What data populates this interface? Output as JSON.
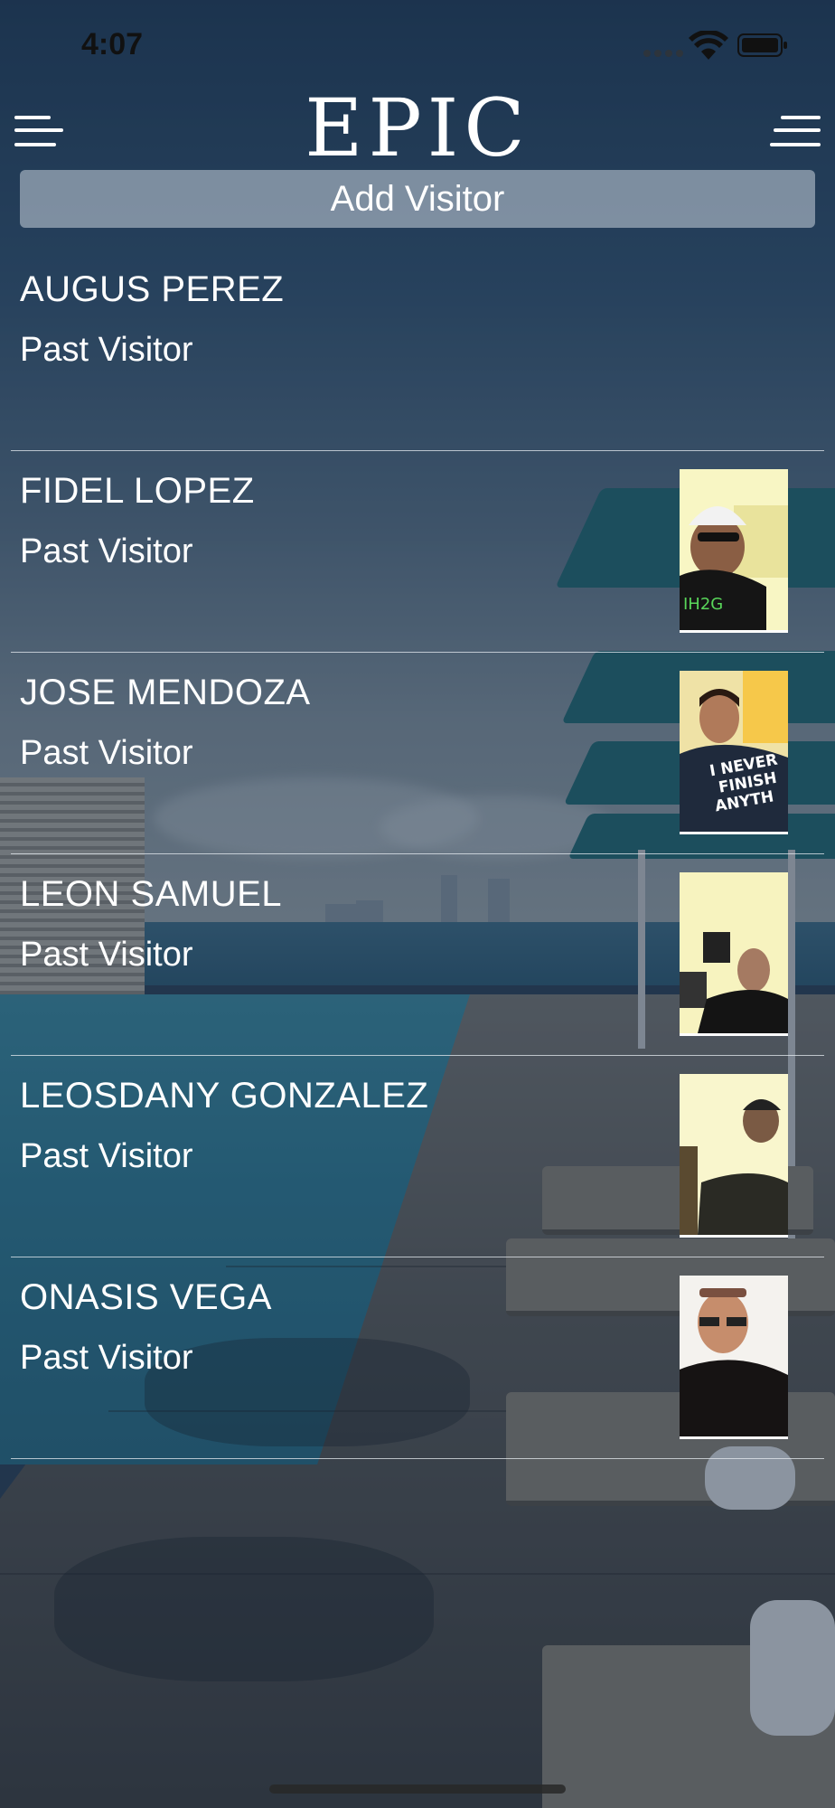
{
  "status_bar": {
    "time": "4:07",
    "icons": [
      "signal-dots-icon",
      "wifi-icon",
      "battery-icon"
    ]
  },
  "nav": {
    "logo": "EPIC",
    "left_icon": "menu-icon",
    "right_icon": "menu-icon"
  },
  "add_visitor": {
    "label": "Add Visitor"
  },
  "visitors": [
    {
      "name": "AUGUS PEREZ",
      "status": "Past Visitor",
      "has_photo": false
    },
    {
      "name": "FIDEL LOPEZ",
      "status": "Past Visitor",
      "has_photo": true,
      "photo": "photo-hat-man"
    },
    {
      "name": "JOSE MENDOZA",
      "status": "Past Visitor",
      "has_photo": true,
      "photo": "photo-shirt-man",
      "shirt_text": "I NEVER FINISH ANYTH"
    },
    {
      "name": "LEON SAMUEL",
      "status": "Past Visitor",
      "has_photo": true,
      "photo": "photo-monitor-man"
    },
    {
      "name": "LEOSDANY GONZALEZ",
      "status": "Past Visitor",
      "has_photo": true,
      "photo": "photo-cap-man"
    },
    {
      "name": "ONASIS VEGA",
      "status": "Past Visitor",
      "has_photo": true,
      "photo": "photo-sunglasses-man"
    }
  ],
  "colors": {
    "text": "#ffffff",
    "button_bg": "#c8d2dc",
    "overlay": "#192d46"
  }
}
